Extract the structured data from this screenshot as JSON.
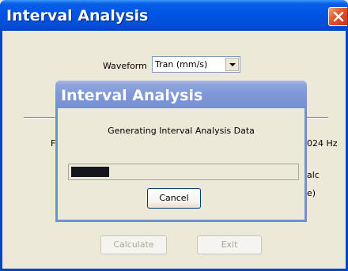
{
  "window": {
    "title": "Interval Analysis",
    "close_icon": "close-icon"
  },
  "form": {
    "waveform_label": "Waveform",
    "waveform_selected": "Tran (mm/s)",
    "partial_text_left": "Fi",
    "partial_text_hz": "024 Hz",
    "partial_text_alc": "alc",
    "partial_text_paren": "e)"
  },
  "buttons": {
    "calculate": "Calculate",
    "exit": "Exit"
  },
  "dialog": {
    "title": "Interval Analysis",
    "message": "Generating Interval Analysis Data",
    "progress": 0.17,
    "cancel": "Cancel"
  },
  "colors": {
    "titlebar": "#0055e5",
    "dialog_titlebar": "#7f98d7",
    "progress_fill": "#15161b",
    "face": "#ece9d8"
  }
}
